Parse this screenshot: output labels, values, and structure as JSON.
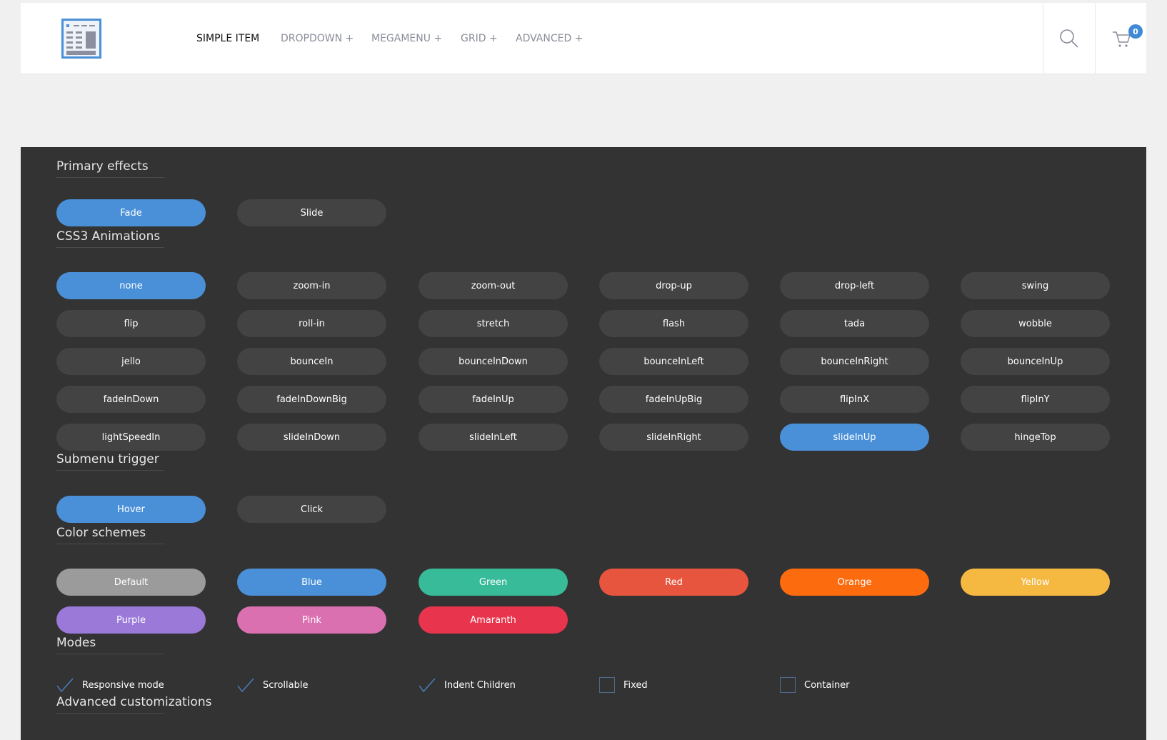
{
  "header": {
    "nav": [
      {
        "label": "SIMPLE ITEM",
        "active": true
      },
      {
        "label": "DROPDOWN +"
      },
      {
        "label": "MEGAMENU +"
      },
      {
        "label": "GRID +"
      },
      {
        "label": "ADVANCED +"
      }
    ],
    "cart_count": "0"
  },
  "sections": {
    "primary": {
      "title": "Primary effects",
      "options": [
        "Fade",
        "Slide"
      ],
      "selected": "Fade"
    },
    "css3": {
      "title": "CSS3 Animations",
      "options": [
        "none",
        "zoom-in",
        "zoom-out",
        "drop-up",
        "drop-left",
        "swing",
        "flip",
        "roll-in",
        "stretch",
        "flash",
        "tada",
        "wobble",
        "jello",
        "bounceIn",
        "bounceInDown",
        "bounceInLeft",
        "bounceInRight",
        "bounceInUp",
        "fadeInDown",
        "fadeInDownBig",
        "fadeInUp",
        "fadeInUpBig",
        "flipInX",
        "flipInY",
        "lightSpeedIn",
        "slideInDown",
        "slideInLeft",
        "slideInRight",
        "slideInUp",
        "hingeTop"
      ],
      "selected": [
        "none",
        "slideInUp"
      ]
    },
    "submenu": {
      "title": "Submenu trigger",
      "options": [
        "Hover",
        "Click"
      ],
      "selected": "Hover"
    },
    "colors": {
      "title": "Color schemes",
      "options": [
        {
          "label": "Default",
          "color": "#9b9b9b"
        },
        {
          "label": "Blue",
          "color": "#4a90d9"
        },
        {
          "label": "Green",
          "color": "#37bb99"
        },
        {
          "label": "Red",
          "color": "#e8553e"
        },
        {
          "label": "Orange",
          "color": "#fd6b0f"
        },
        {
          "label": "Yellow",
          "color": "#f5b942"
        },
        {
          "label": "Purple",
          "color": "#9b79d9"
        },
        {
          "label": "Pink",
          "color": "#db70b0"
        },
        {
          "label": "Amaranth",
          "color": "#e8344c"
        }
      ]
    },
    "modes": {
      "title": "Modes",
      "options": [
        {
          "label": "Responsive mode",
          "checked": true
        },
        {
          "label": "Scrollable",
          "checked": true
        },
        {
          "label": "Indent Children",
          "checked": true
        },
        {
          "label": "Fixed",
          "checked": false
        },
        {
          "label": "Container",
          "checked": false
        }
      ]
    },
    "advanced": {
      "title": "Advanced customizations"
    }
  },
  "accent": "#4a90d9"
}
